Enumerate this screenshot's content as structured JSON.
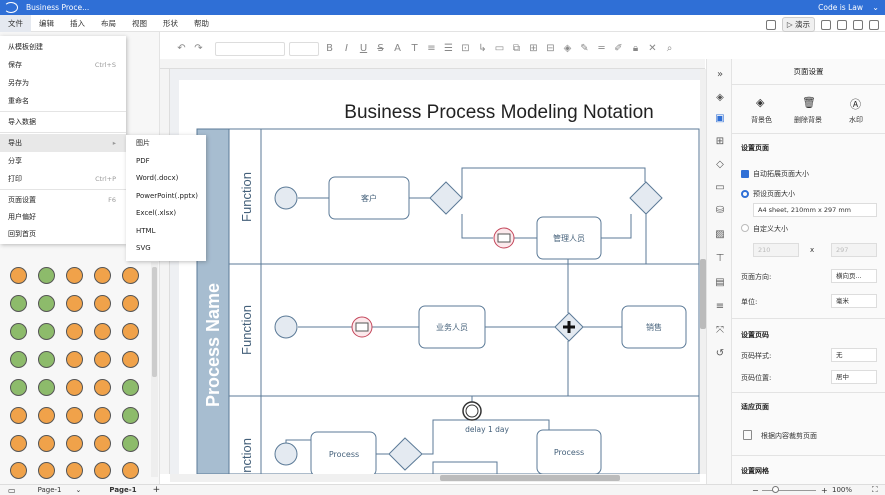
{
  "window": {
    "title": "Business Proce...",
    "user": "Code is Law"
  },
  "menu": {
    "items": [
      "文件",
      "编辑",
      "插入",
      "布局",
      "视图",
      "形状",
      "帮助"
    ],
    "present_label": "演示"
  },
  "file_menu": {
    "items": [
      {
        "label": "从模板创建",
        "shortcut": ""
      },
      {
        "label": "保存",
        "shortcut": "Ctrl+S"
      },
      {
        "label": "另存为",
        "shortcut": ""
      },
      {
        "label": "重命名",
        "shortcut": ""
      },
      {
        "label": "导入数据",
        "shortcut": ""
      },
      {
        "label": "导出",
        "shortcut": "▸"
      },
      {
        "label": "分享",
        "shortcut": ""
      },
      {
        "label": "打印",
        "shortcut": "Ctrl+P"
      },
      {
        "label": "页面设置",
        "shortcut": "F6"
      },
      {
        "label": "用户偏好",
        "shortcut": ""
      },
      {
        "label": "回到首页",
        "shortcut": ""
      }
    ]
  },
  "export_submenu": {
    "items": [
      "图片",
      "PDF",
      "Word(.docx)",
      "PowerPoint(.pptx)",
      "Excel(.xlsx)",
      "HTML",
      "SVG"
    ]
  },
  "diagram": {
    "title": "Business Process Modeling Notation",
    "pool": "Process Name",
    "lanes": [
      "Function",
      "Function",
      "Function"
    ],
    "tasks": {
      "customer": "客户",
      "manager": "管理人员",
      "staff": "业务人员",
      "sales": "销售",
      "process1": "Process",
      "process2": "Process"
    },
    "timer_label": "delay 1 day"
  },
  "right_panel": {
    "title": "页面设置",
    "bg_color": "背景色",
    "remove_bg": "删除背景",
    "watermark": "水印",
    "section_page": "设置页面",
    "auto_expand": "自动拓展页面大小",
    "preset_size": "预设页面大小",
    "preset_value": "A4 sheet, 210mm x 297 mm",
    "custom_size": "自定义大小",
    "custom_w": "210",
    "custom_x": "x",
    "custom_h": "297",
    "orientation_label": "页面方向:",
    "orientation_value": "横向页...",
    "unit_label": "单位:",
    "unit_value": "毫米",
    "section_pagenum": "设置页码",
    "pagenum_style_label": "页码样式:",
    "pagenum_style_value": "无",
    "pagenum_pos_label": "页码位置:",
    "pagenum_pos_value": "居中",
    "section_fit": "适应页面",
    "fit_content": "根据内容裁剪页面",
    "section_grid": "设置网格"
  },
  "status": {
    "page_tab1": "Page-1",
    "page_tab2": "Page-1",
    "add": "+",
    "zoom": "100%"
  },
  "colors": {
    "accent": "#2f6fd6",
    "pool": "#a7bdd0",
    "shape_fill": "#e4eaf1",
    "shape_stroke": "#5b7a97",
    "message": "#c4475b",
    "shape_orange": "#f0a24a",
    "shape_green": "#8dbb6b"
  }
}
